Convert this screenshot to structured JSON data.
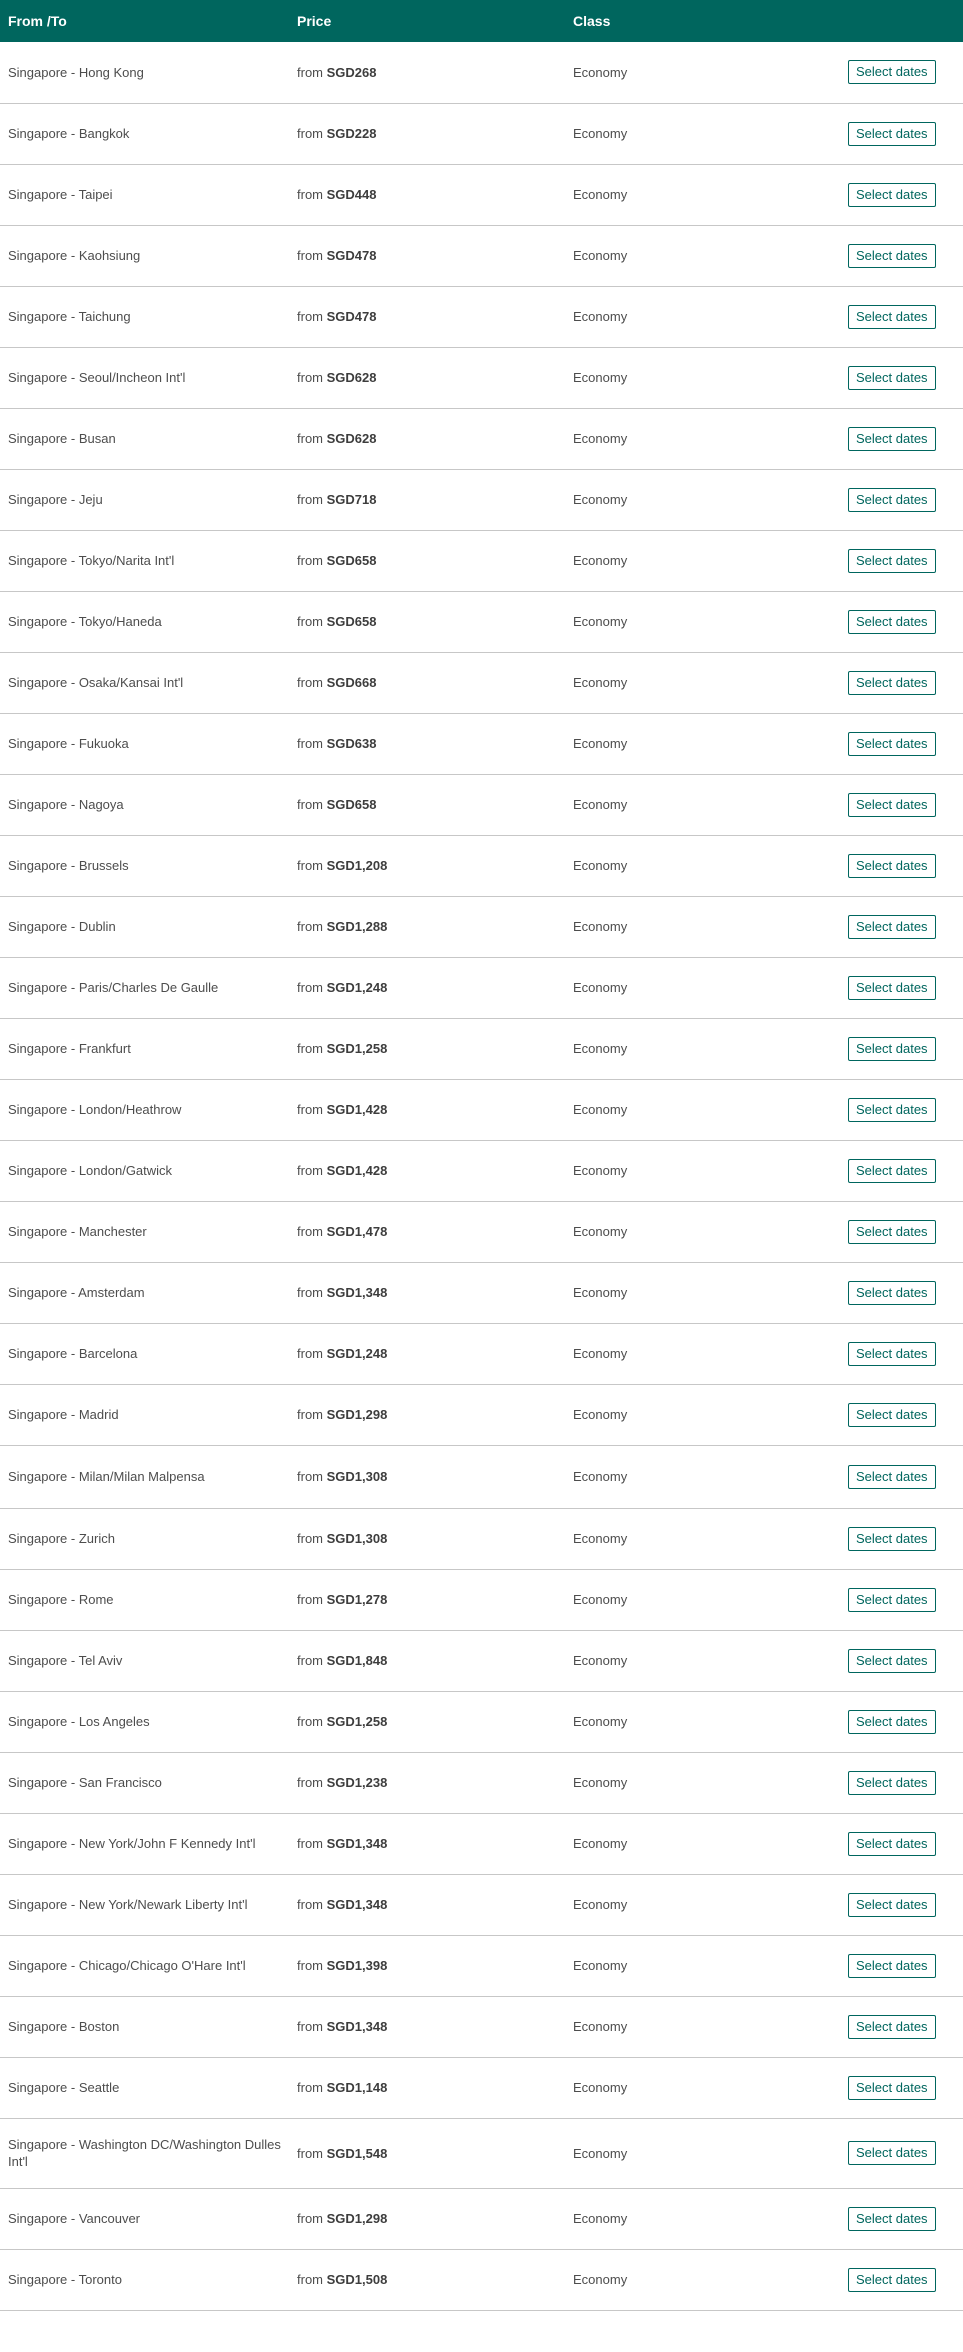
{
  "header": {
    "from_to": "From /To",
    "price": "Price",
    "class": "Class"
  },
  "fares": [
    {
      "route": "Singapore - Hong Kong",
      "price_prefix": "from",
      "price": "SGD268",
      "class": "Economy",
      "action": "Select dates"
    },
    {
      "route": "Singapore - Bangkok",
      "price_prefix": "from",
      "price": "SGD228",
      "class": "Economy",
      "action": "Select dates"
    },
    {
      "route": "Singapore - Taipei",
      "price_prefix": "from",
      "price": "SGD448",
      "class": "Economy",
      "action": "Select dates"
    },
    {
      "route": "Singapore - Kaohsiung",
      "price_prefix": "from",
      "price": "SGD478",
      "class": "Economy",
      "action": "Select dates"
    },
    {
      "route": "Singapore - Taichung",
      "price_prefix": "from",
      "price": "SGD478",
      "class": "Economy",
      "action": "Select dates"
    },
    {
      "route": "Singapore - Seoul/Incheon Int'l",
      "price_prefix": "from",
      "price": "SGD628",
      "class": "Economy",
      "action": "Select dates"
    },
    {
      "route": "Singapore - Busan",
      "price_prefix": "from",
      "price": "SGD628",
      "class": "Economy",
      "action": "Select dates"
    },
    {
      "route": "Singapore - Jeju",
      "price_prefix": "from",
      "price": "SGD718",
      "class": "Economy",
      "action": "Select dates"
    },
    {
      "route": "Singapore - Tokyo/Narita Int'l",
      "price_prefix": "from",
      "price": "SGD658",
      "class": "Economy",
      "action": "Select dates"
    },
    {
      "route": "Singapore - Tokyo/Haneda",
      "price_prefix": "from",
      "price": "SGD658",
      "class": "Economy",
      "action": "Select dates"
    },
    {
      "route": "Singapore - Osaka/Kansai Int'l",
      "price_prefix": "from",
      "price": "SGD668",
      "class": "Economy",
      "action": "Select dates"
    },
    {
      "route": "Singapore - Fukuoka",
      "price_prefix": "from",
      "price": "SGD638",
      "class": "Economy",
      "action": "Select dates"
    },
    {
      "route": "Singapore - Nagoya",
      "price_prefix": "from",
      "price": "SGD658",
      "class": "Economy",
      "action": "Select dates"
    },
    {
      "route": "Singapore - Brussels",
      "price_prefix": "from",
      "price": "SGD1,208",
      "class": "Economy",
      "action": "Select dates"
    },
    {
      "route": "Singapore - Dublin",
      "price_prefix": "from",
      "price": "SGD1,288",
      "class": "Economy",
      "action": "Select dates"
    },
    {
      "route": "Singapore - Paris/Charles De Gaulle",
      "price_prefix": "from",
      "price": "SGD1,248",
      "class": "Economy",
      "action": "Select dates"
    },
    {
      "route": "Singapore - Frankfurt",
      "price_prefix": "from",
      "price": "SGD1,258",
      "class": "Economy",
      "action": "Select dates"
    },
    {
      "route": "Singapore - London/Heathrow",
      "price_prefix": "from",
      "price": "SGD1,428",
      "class": "Economy",
      "action": "Select dates"
    },
    {
      "route": "Singapore - London/Gatwick",
      "price_prefix": "from",
      "price": "SGD1,428",
      "class": "Economy",
      "action": "Select dates"
    },
    {
      "route": "Singapore - Manchester",
      "price_prefix": "from",
      "price": "SGD1,478",
      "class": "Economy",
      "action": "Select dates"
    },
    {
      "route": "Singapore - Amsterdam",
      "price_prefix": "from",
      "price": "SGD1,348",
      "class": "Economy",
      "action": "Select dates"
    },
    {
      "route": "Singapore - Barcelona",
      "price_prefix": "from",
      "price": "SGD1,248",
      "class": "Economy",
      "action": "Select dates"
    },
    {
      "route": "Singapore - Madrid",
      "price_prefix": "from",
      "price": "SGD1,298",
      "class": "Economy",
      "action": "Select dates"
    },
    {
      "route": "Singapore - Milan/Milan Malpensa",
      "price_prefix": "from",
      "price": "SGD1,308",
      "class": "Economy",
      "action": "Select dates"
    },
    {
      "route": "Singapore - Zurich",
      "price_prefix": "from",
      "price": "SGD1,308",
      "class": "Economy",
      "action": "Select dates"
    },
    {
      "route": "Singapore - Rome",
      "price_prefix": "from",
      "price": "SGD1,278",
      "class": "Economy",
      "action": "Select dates"
    },
    {
      "route": "Singapore - Tel Aviv",
      "price_prefix": "from",
      "price": "SGD1,848",
      "class": "Economy",
      "action": "Select dates"
    },
    {
      "route": "Singapore - Los Angeles",
      "price_prefix": "from",
      "price": "SGD1,258",
      "class": "Economy",
      "action": "Select dates"
    },
    {
      "route": "Singapore - San Francisco",
      "price_prefix": "from",
      "price": "SGD1,238",
      "class": "Economy",
      "action": "Select dates"
    },
    {
      "route": "Singapore - New York/John F Kennedy Int'l",
      "price_prefix": "from",
      "price": "SGD1,348",
      "class": "Economy",
      "action": "Select dates"
    },
    {
      "route": "Singapore - New York/Newark Liberty Int'l",
      "price_prefix": "from",
      "price": "SGD1,348",
      "class": "Economy",
      "action": "Select dates"
    },
    {
      "route": "Singapore - Chicago/Chicago O'Hare Int'l",
      "price_prefix": "from",
      "price": "SGD1,398",
      "class": "Economy",
      "action": "Select dates"
    },
    {
      "route": "Singapore - Boston",
      "price_prefix": "from",
      "price": "SGD1,348",
      "class": "Economy",
      "action": "Select dates"
    },
    {
      "route": "Singapore - Seattle",
      "price_prefix": "from",
      "price": "SGD1,148",
      "class": "Economy",
      "action": "Select dates"
    },
    {
      "route": "Singapore - Washington DC/Washington Dulles Int'l",
      "price_prefix": "from",
      "price": "SGD1,548",
      "class": "Economy",
      "action": "Select dates"
    },
    {
      "route": "Singapore - Vancouver",
      "price_prefix": "from",
      "price": "SGD1,298",
      "class": "Economy",
      "action": "Select dates"
    },
    {
      "route": "Singapore - Toronto",
      "price_prefix": "from",
      "price": "SGD1,508",
      "class": "Economy",
      "action": "Select dates"
    }
  ],
  "colors": {
    "header_bg": "#00665e",
    "accent": "#00665e",
    "divider": "#c7c7c7"
  }
}
